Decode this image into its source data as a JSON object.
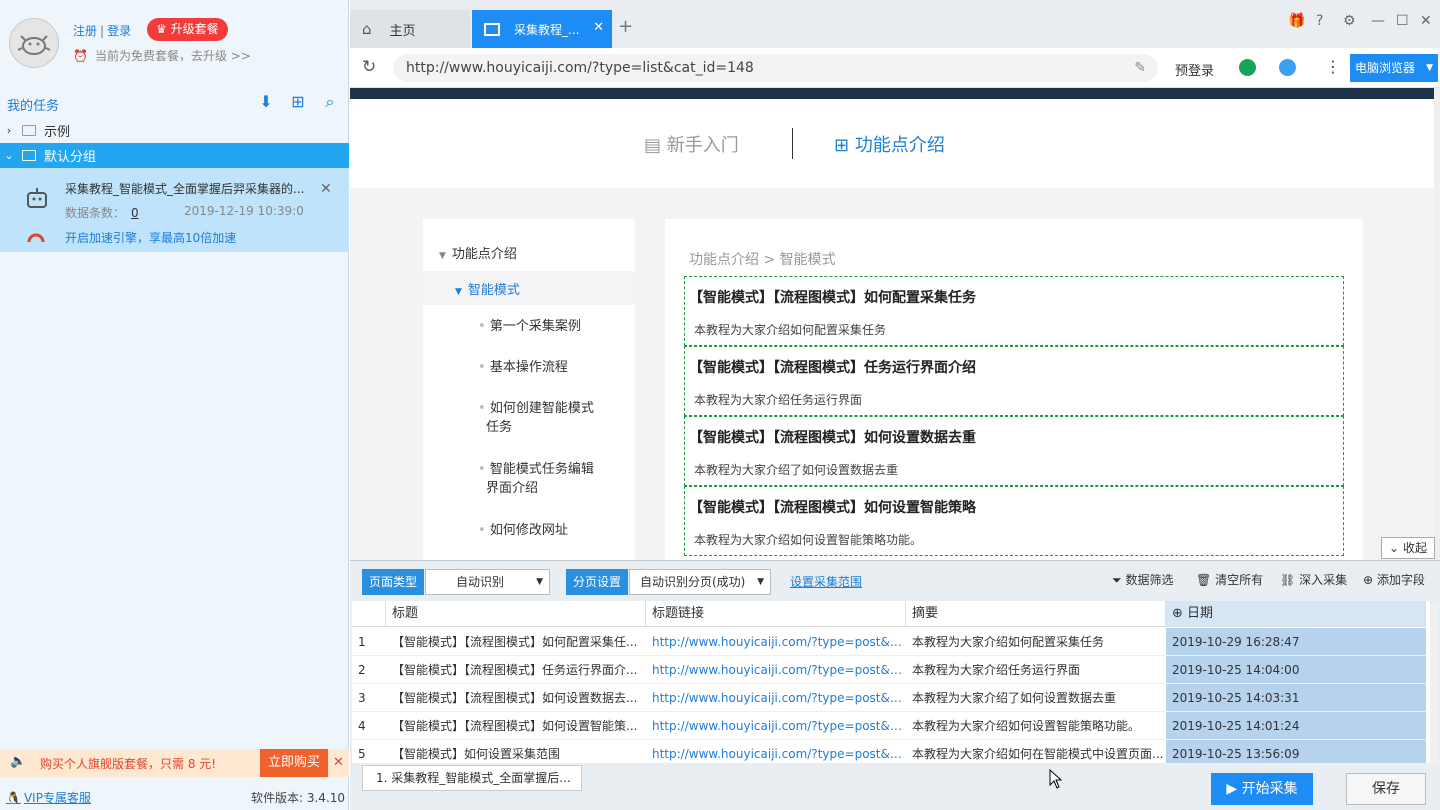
{
  "account": {
    "register": "注册",
    "login": "登录",
    "upgrade": "升级套餐",
    "plan_notice": "当前为免费套餐，去升级 >>"
  },
  "tasks": {
    "title": "我的任务",
    "groups": [
      "示例",
      "默认分组"
    ],
    "task": {
      "title": "采集教程_智能模式_全面掌握后羿采集器的...",
      "count_label": "数据条数：",
      "count": "0",
      "date": "2019-12-19 10:39:0",
      "accel": "开启加速引擎，享最高10倍加速"
    }
  },
  "promo": {
    "text": "购买个人旗舰版套餐，只需 8 元!",
    "button": "立即购买"
  },
  "footer": {
    "vip": "VIP专属客服",
    "version": "软件版本: 3.4.10"
  },
  "browser": {
    "tabs": [
      "主页",
      "采集教程_..."
    ],
    "url": "http://www.houyicaiji.com/?type=list&cat_id=148",
    "prelogin": "预登录",
    "browser_select": "电脑浏览器"
  },
  "page": {
    "nav": [
      "新手入门",
      "功能点介绍"
    ],
    "sidebar": [
      "功能点介绍",
      "智能模式",
      "第一个采集案例",
      "基本操作流程",
      "如何创建智能模式",
      "任务",
      "智能模式任务编辑",
      "界面介绍",
      "如何修改网址"
    ],
    "breadcrumb": "功能点介绍 > 智能模式",
    "articles": [
      {
        "title": "【智能模式】【流程图模式】如何配置采集任务",
        "desc": "本教程为大家介绍如何配置采集任务"
      },
      {
        "title": "【智能模式】【流程图模式】任务运行界面介绍",
        "desc": "本教程为大家介绍任务运行界面"
      },
      {
        "title": "【智能模式】【流程图模式】如何设置数据去重",
        "desc": "本教程为大家介绍了如何设置数据去重"
      },
      {
        "title": "【智能模式】【流程图模式】如何设置智能策略",
        "desc": "本教程为大家介绍如何设置智能策略功能。"
      }
    ],
    "collapse": "收起"
  },
  "bottom": {
    "page_type_label": "页面类型",
    "page_type": "自动识别",
    "paging_label": "分页设置",
    "paging": "自动识别分页(成功)",
    "range": "设置采集范围",
    "tools": [
      "数据筛选",
      "清空所有",
      "深入采集",
      "添加字段"
    ],
    "columns": [
      "标题",
      "标题链接",
      "摘要",
      "日期"
    ],
    "rows": [
      [
        "1",
        "【智能模式】【流程图模式】如何配置采集任...",
        "http://www.houyicaiji.com/?type=post&pid=7...",
        "本教程为大家介绍如何配置采集任务",
        "2019-10-29 16:28:47"
      ],
      [
        "2",
        "【智能模式】【流程图模式】任务运行界面介...",
        "http://www.houyicaiji.com/?type=post&pid=7...",
        "本教程为大家介绍任务运行界面",
        "2019-10-25 14:04:00"
      ],
      [
        "3",
        "【智能模式】【流程图模式】如何设置数据去...",
        "http://www.houyicaiji.com/?type=post&pid=7...",
        "本教程为大家介绍了如何设置数据去重",
        "2019-10-25 14:03:31"
      ],
      [
        "4",
        "【智能模式】【流程图模式】如何设置智能策...",
        "http://www.houyicaiji.com/?type=post&pid=7...",
        "本教程为大家介绍如何设置智能策略功能。",
        "2019-10-25 14:01:24"
      ],
      [
        "5",
        "【智能模式】如何设置采集范围",
        "http://www.houyicaiji.com/?type=post&pid=7...",
        "本教程为大家介绍如何在智能模式中设置页面...",
        "2019-10-25 13:56:09"
      ]
    ],
    "task_tab": "1. 采集教程_智能模式_全面掌握后...",
    "start": "开始采集",
    "save": "保存"
  }
}
